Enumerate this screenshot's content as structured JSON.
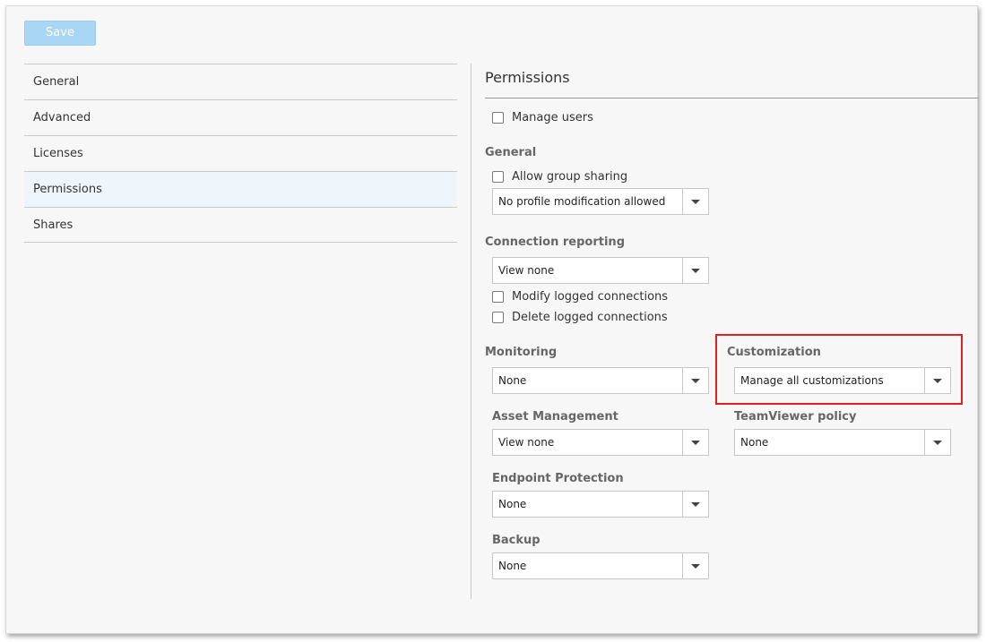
{
  "toolbar": {
    "save_label": "Save"
  },
  "sidebar": {
    "items": [
      {
        "label": "General"
      },
      {
        "label": "Advanced"
      },
      {
        "label": "Licenses"
      },
      {
        "label": "Permissions",
        "active": true
      },
      {
        "label": "Shares"
      }
    ]
  },
  "panel": {
    "title": "Permissions",
    "manage_users_label": "Manage users",
    "general": {
      "heading": "General",
      "allow_group_sharing_label": "Allow group sharing",
      "profile_select": "No profile modification allowed"
    },
    "connection_reporting": {
      "heading": "Connection reporting",
      "select": "View none",
      "modify_label": "Modify logged connections",
      "delete_label": "Delete logged connections"
    },
    "monitoring": {
      "heading": "Monitoring",
      "select": "None"
    },
    "customization": {
      "heading": "Customization",
      "select": "Manage all customizations"
    },
    "asset_management": {
      "heading": "Asset Management",
      "select": "View none"
    },
    "teamviewer_policy": {
      "heading": "TeamViewer policy",
      "select": "None"
    },
    "endpoint_protection": {
      "heading": "Endpoint Protection",
      "select": "None"
    },
    "backup": {
      "heading": "Backup",
      "select": "None"
    }
  },
  "colors": {
    "save_button_bg": "#a9d6f5",
    "active_item_bg": "#eef6fb",
    "highlight": "#e02222"
  }
}
